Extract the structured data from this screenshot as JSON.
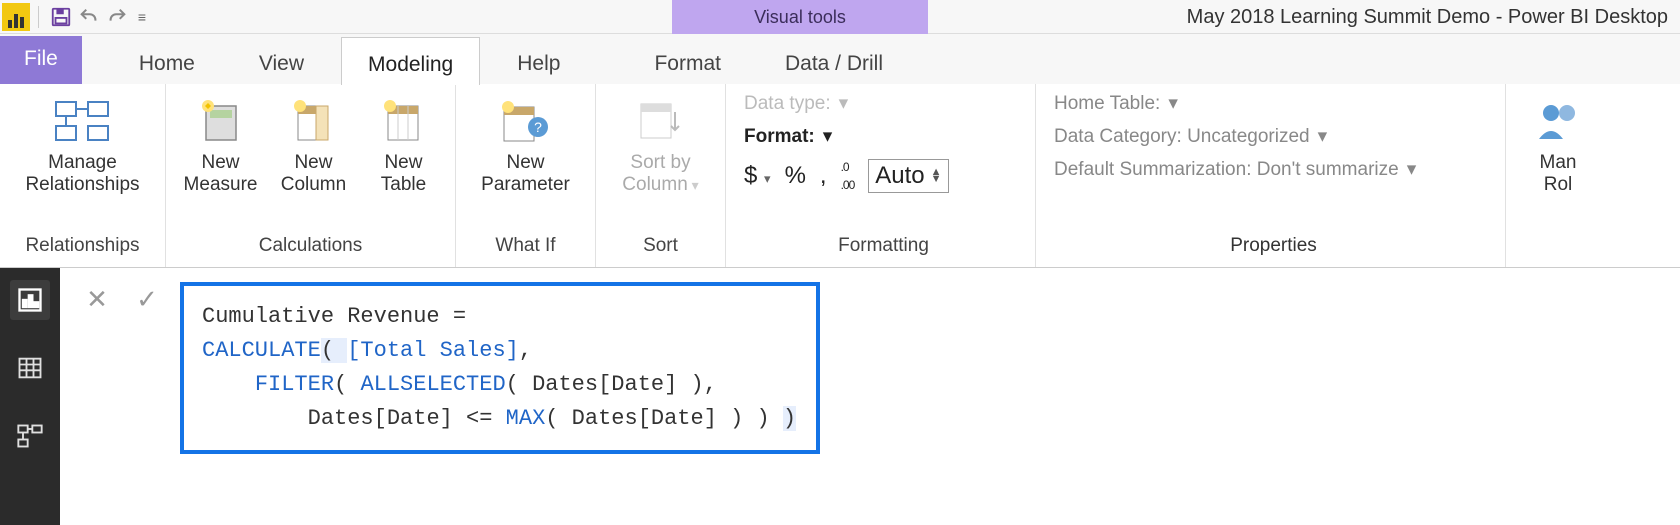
{
  "titlebar": {
    "tool_context": "Visual tools",
    "window_title": "May 2018 Learning Summit Demo - Power BI Desktop"
  },
  "tabs": {
    "file": "File",
    "items": [
      "Home",
      "View",
      "Modeling",
      "Help",
      "Format",
      "Data / Drill"
    ],
    "active_index": 2
  },
  "ribbon": {
    "groups": {
      "relationships": {
        "label": "Relationships",
        "manage": "Manage\nRelationships"
      },
      "calculations": {
        "label": "Calculations",
        "new_measure": "New\nMeasure",
        "new_column": "New\nColumn",
        "new_table": "New\nTable"
      },
      "whatif": {
        "label": "What If",
        "new_param": "New\nParameter"
      },
      "sort": {
        "label": "Sort",
        "sort_by": "Sort by\nColumn"
      },
      "formatting": {
        "label": "Formatting",
        "data_type": "Data type:",
        "format": "Format:",
        "currency": "$",
        "percent": "%",
        "thousand": ",",
        "decimal_icon": ".0",
        "auto": "Auto"
      },
      "properties": {
        "label": "Properties",
        "home_table": "Home Table:",
        "data_category": "Data Category: Uncategorized",
        "default_summ": "Default Summarization: Don't summarize"
      },
      "security": {
        "manage_roles": "Man\nRol"
      }
    }
  },
  "formula": {
    "line1_a": "Cumulative Revenue = ",
    "line2_kw": "CALCULATE",
    "line2_open": "( ",
    "line2_meas": "[Total Sales]",
    "line2_rest": ",",
    "line3_pad": "    ",
    "line3_kw": "FILTER",
    "line3_open": "( ",
    "line3_kw2": "ALLSELECTED",
    "line3_rest": "( Dates[Date] ),",
    "line4_pad": "        ",
    "line4_a": "Dates[Date] <= ",
    "line4_kw": "MAX",
    "line4_rest": "( Dates[Date] ) ) ",
    "line4_close": ")"
  }
}
